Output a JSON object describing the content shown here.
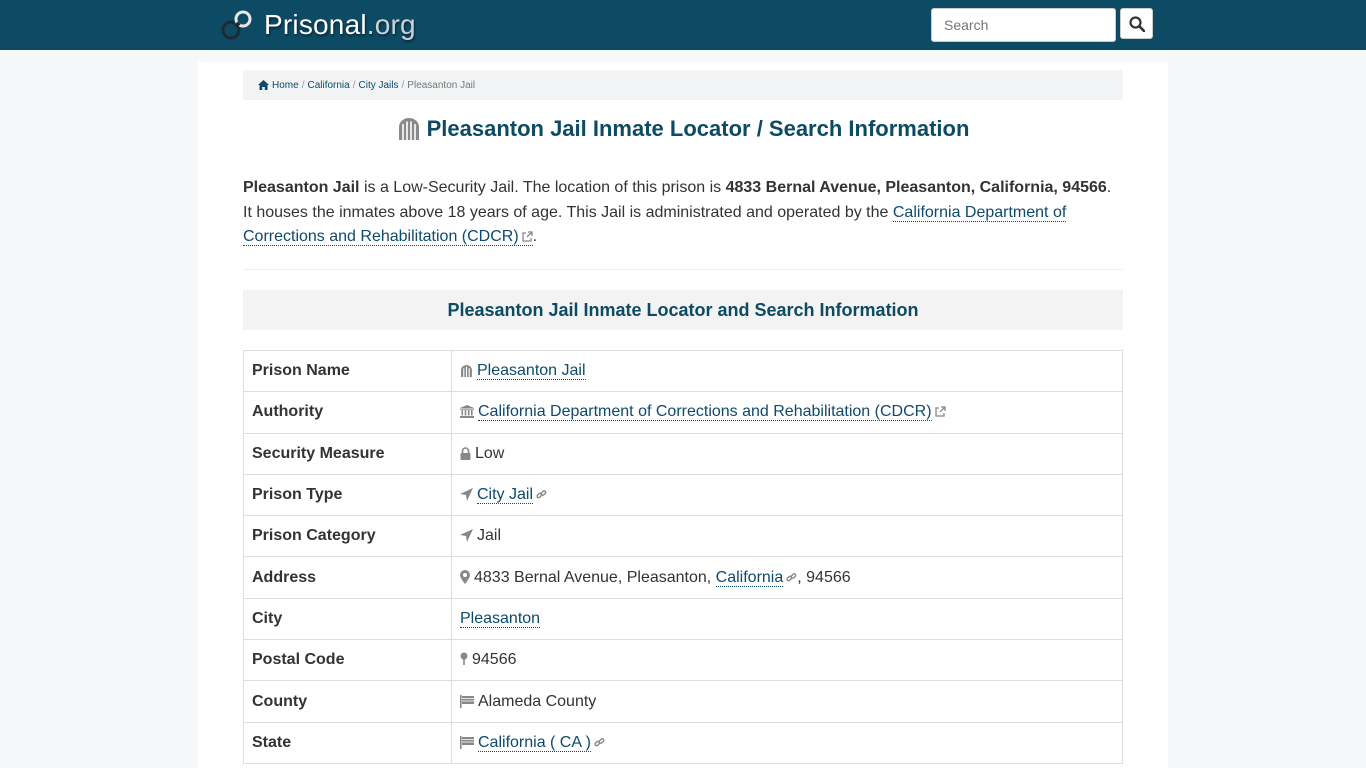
{
  "header": {
    "logo_name": "Prisonal",
    "logo_tld": ".org",
    "search_placeholder": "Search"
  },
  "breadcrumb": {
    "home": "Home",
    "state": "California",
    "category": "City Jails",
    "current": "Pleasanton Jail"
  },
  "page_title": "Pleasanton Jail Inmate Locator / Search Information",
  "intro": {
    "name": "Pleasanton Jail",
    "text1": " is a Low-Security Jail. The location of this prison is ",
    "address": "4833 Bernal Avenue, Pleasanton, California, 94566",
    "text2": ". It houses the inmates above 18 years of age. This Jail is administrated and operated by the ",
    "authority_link": "California Department of Corrections and Rehabilitation (CDCR)",
    "text3": "."
  },
  "section_title": "Pleasanton Jail Inmate Locator and Search Information",
  "table": {
    "prison_name": {
      "label": "Prison Name",
      "value": "Pleasanton Jail"
    },
    "authority": {
      "label": "Authority",
      "value": "California Department of Corrections and Rehabilitation (CDCR)"
    },
    "security": {
      "label": "Security Measure",
      "value": "Low"
    },
    "type": {
      "label": "Prison Type",
      "value": "City Jail"
    },
    "category": {
      "label": "Prison Category",
      "value": "Jail"
    },
    "address": {
      "label": "Address",
      "street": "4833 Bernal Avenue, Pleasanton, ",
      "state_link": "California",
      "zip": ", 94566"
    },
    "city": {
      "label": "City",
      "value": "Pleasanton"
    },
    "postal": {
      "label": "Postal Code",
      "value": "94566"
    },
    "county": {
      "label": "County",
      "value": "Alameda County"
    },
    "state": {
      "label": "State",
      "value": "California ( CA )"
    }
  },
  "colors": {
    "header_bg": "#0d4a64",
    "link": "#0d4a6b",
    "title": "#0d4a64"
  }
}
